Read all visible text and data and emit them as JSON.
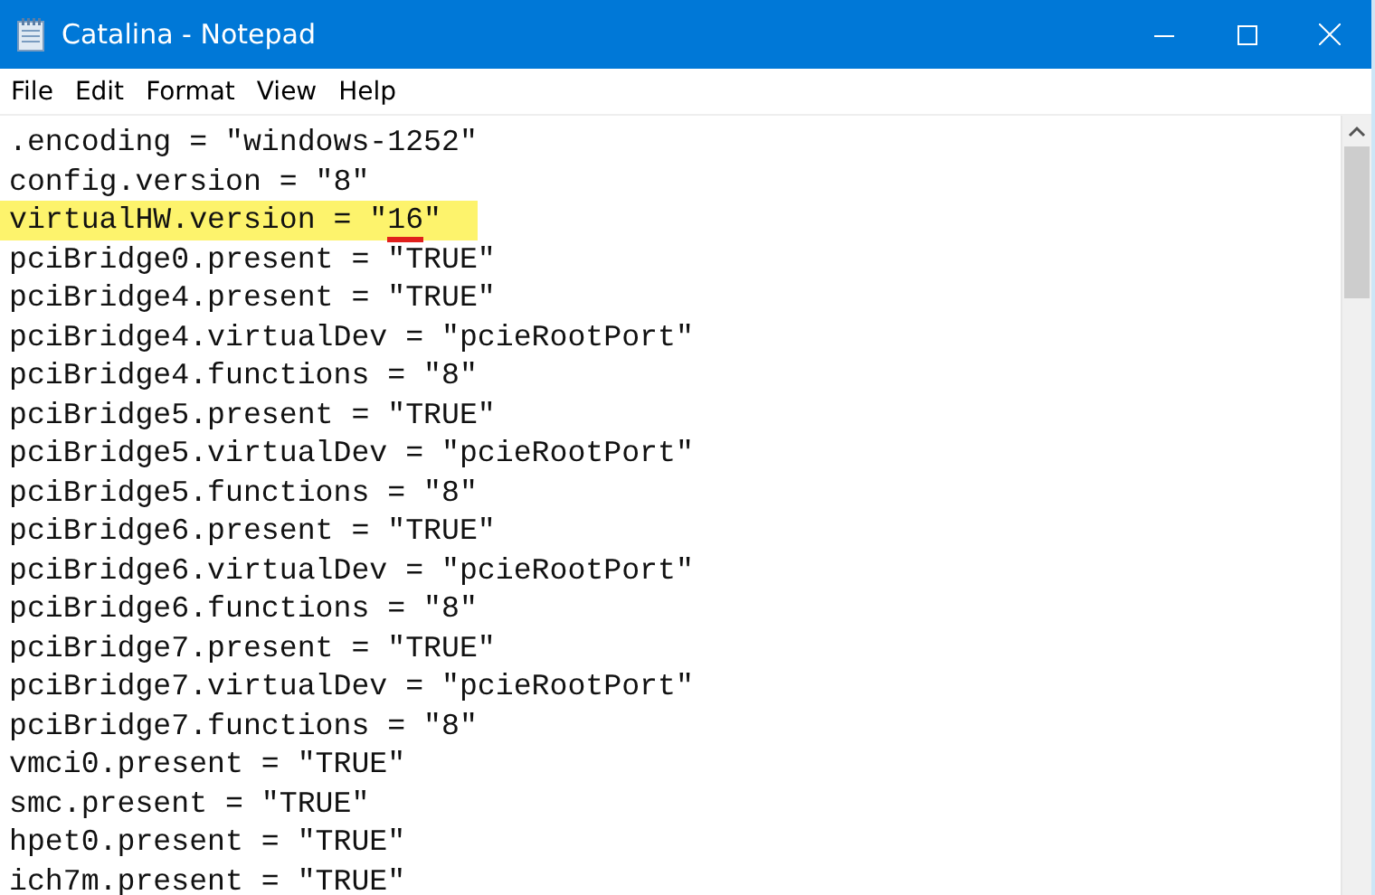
{
  "window": {
    "title": "Catalina - Notepad"
  },
  "menu": [
    "File",
    "Edit",
    "Format",
    "View",
    "Help"
  ],
  "lines": [
    {
      "parts": [
        {
          "text": ".encoding = \"windows-1252\"",
          "underlined": false
        }
      ],
      "highlighted": false
    },
    {
      "parts": [
        {
          "text": "config.version = \"8\"",
          "underlined": false
        }
      ],
      "highlighted": false
    },
    {
      "parts": [
        {
          "text": "virtualHW.version = \"",
          "underlined": false
        },
        {
          "text": "16",
          "underlined": true
        },
        {
          "text": "\"",
          "underlined": false
        }
      ],
      "highlighted": true
    },
    {
      "parts": [
        {
          "text": "pciBridge0.present = \"TRUE\"",
          "underlined": false
        }
      ],
      "highlighted": false
    },
    {
      "parts": [
        {
          "text": "pciBridge4.present = \"TRUE\"",
          "underlined": false
        }
      ],
      "highlighted": false
    },
    {
      "parts": [
        {
          "text": "pciBridge4.virtualDev = \"pcieRootPort\"",
          "underlined": false
        }
      ],
      "highlighted": false
    },
    {
      "parts": [
        {
          "text": "pciBridge4.functions = \"8\"",
          "underlined": false
        }
      ],
      "highlighted": false
    },
    {
      "parts": [
        {
          "text": "pciBridge5.present = \"TRUE\"",
          "underlined": false
        }
      ],
      "highlighted": false
    },
    {
      "parts": [
        {
          "text": "pciBridge5.virtualDev = \"pcieRootPort\"",
          "underlined": false
        }
      ],
      "highlighted": false
    },
    {
      "parts": [
        {
          "text": "pciBridge5.functions = \"8\"",
          "underlined": false
        }
      ],
      "highlighted": false
    },
    {
      "parts": [
        {
          "text": "pciBridge6.present = \"TRUE\"",
          "underlined": false
        }
      ],
      "highlighted": false
    },
    {
      "parts": [
        {
          "text": "pciBridge6.virtualDev = \"pcieRootPort\"",
          "underlined": false
        }
      ],
      "highlighted": false
    },
    {
      "parts": [
        {
          "text": "pciBridge6.functions = \"8\"",
          "underlined": false
        }
      ],
      "highlighted": false
    },
    {
      "parts": [
        {
          "text": "pciBridge7.present = \"TRUE\"",
          "underlined": false
        }
      ],
      "highlighted": false
    },
    {
      "parts": [
        {
          "text": "pciBridge7.virtualDev = \"pcieRootPort\"",
          "underlined": false
        }
      ],
      "highlighted": false
    },
    {
      "parts": [
        {
          "text": "pciBridge7.functions = \"8\"",
          "underlined": false
        }
      ],
      "highlighted": false
    },
    {
      "parts": [
        {
          "text": "vmci0.present = \"TRUE\"",
          "underlined": false
        }
      ],
      "highlighted": false
    },
    {
      "parts": [
        {
          "text": "smc.present = \"TRUE\"",
          "underlined": false
        }
      ],
      "highlighted": false
    },
    {
      "parts": [
        {
          "text": "hpet0.present = \"TRUE\"",
          "underlined": false
        }
      ],
      "highlighted": false
    },
    {
      "parts": [
        {
          "text": "ich7m.present = \"TRUE\"",
          "underlined": false
        }
      ],
      "highlighted": false
    }
  ]
}
